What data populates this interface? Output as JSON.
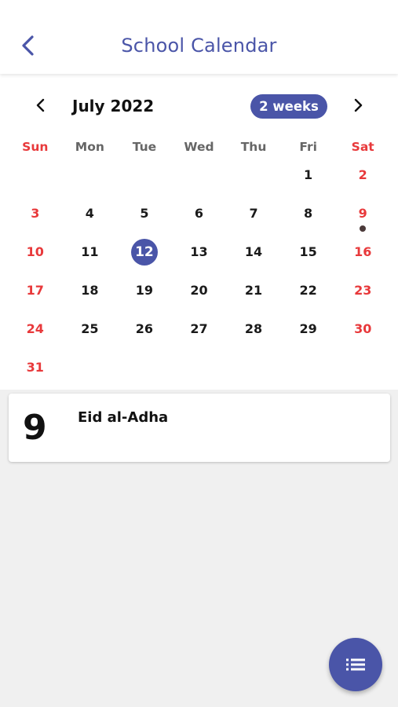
{
  "appbar": {
    "title": "School Calendar",
    "back_icon": "chevron-left-icon"
  },
  "calendar": {
    "month_label": "July 2022",
    "format_button_label": "2 weeks",
    "prev_icon": "chevron-left-icon",
    "next_icon": "chevron-right-icon",
    "weekdays": [
      "Sun",
      "Mon",
      "Tue",
      "Wed",
      "Thu",
      "Fri",
      "Sat"
    ],
    "selected_day": "12",
    "event_days": [
      "9"
    ],
    "weeks": [
      [
        "",
        "",
        "",
        "",
        "",
        "1",
        "2"
      ],
      [
        "3",
        "4",
        "5",
        "6",
        "7",
        "8",
        "9"
      ],
      [
        "10",
        "11",
        "12",
        "13",
        "14",
        "15",
        "16"
      ],
      [
        "17",
        "18",
        "19",
        "20",
        "21",
        "22",
        "23"
      ],
      [
        "24",
        "25",
        "26",
        "27",
        "28",
        "29",
        "30"
      ],
      [
        "31",
        "",
        "",
        "",
        "",
        "",
        ""
      ]
    ]
  },
  "events": [
    {
      "day": "9",
      "title": "Eid al-Adha"
    }
  ],
  "fab": {
    "icon": "list-icon"
  },
  "colors": {
    "accent": "#4a55a8",
    "weekend": "#e8393b",
    "event_dot": "#4b3a3a",
    "background": "#f0f0f0"
  }
}
